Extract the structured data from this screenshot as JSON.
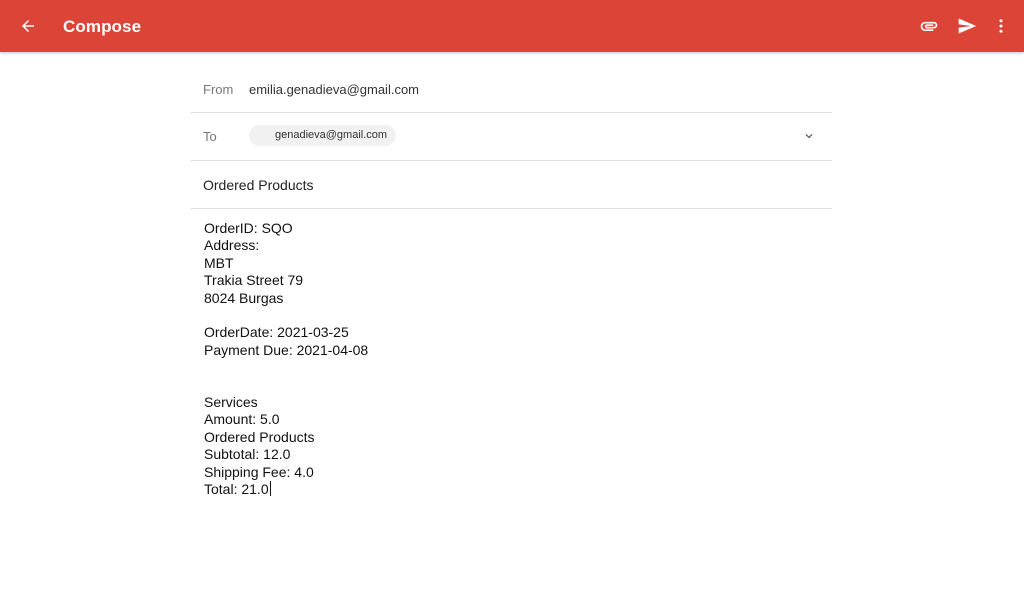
{
  "appbar": {
    "title": "Compose",
    "color": "#db4437",
    "icons": {
      "back": "arrow-back-icon",
      "attach": "paperclip-icon",
      "send": "send-icon",
      "more": "more-vert-icon"
    }
  },
  "compose": {
    "from_label": "From",
    "from_value": "emilia.genadieva@gmail.com",
    "to_label": "To",
    "to_recipient": "genadieva@gmail.com",
    "subject": "Ordered Products",
    "body_lines": [
      "OrderID: SQO",
      "Address:",
      "MBT",
      "Trakia Street 79",
      "8024 Burgas",
      "",
      "OrderDate: 2021-03-25",
      "Payment Due: 2021-04-08",
      "",
      "",
      "Services",
      "Amount: 5.0",
      "Ordered Products",
      "Subtotal: 12.0",
      "Shipping Fee: 4.0",
      "Total: 21.0"
    ]
  }
}
